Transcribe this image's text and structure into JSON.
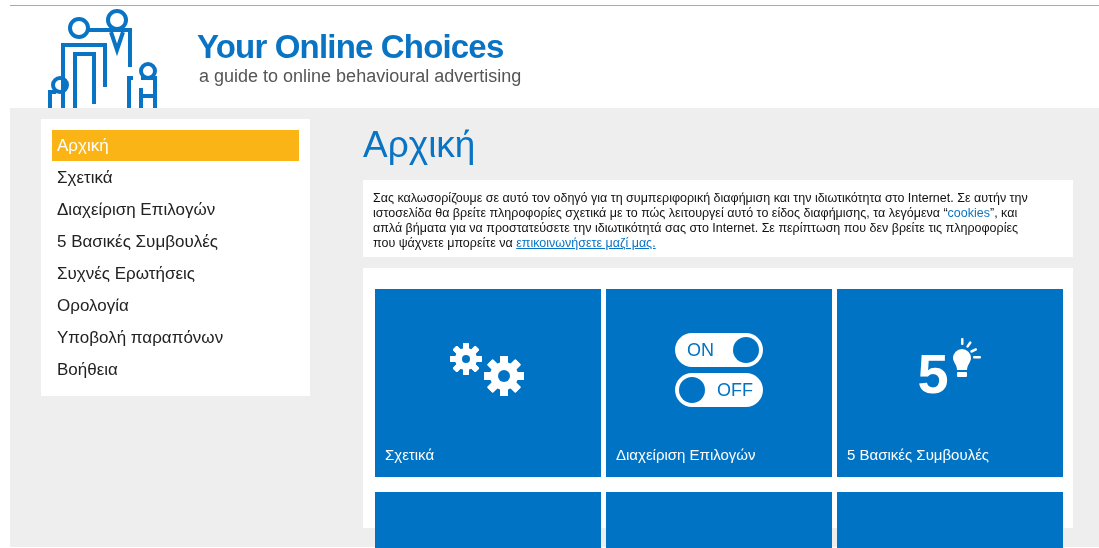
{
  "header": {
    "title": "Your Online Choices",
    "subtitle": "a guide to online behavioural advertising"
  },
  "sidebar": {
    "items": [
      {
        "label": "Αρχική",
        "selected": true
      },
      {
        "label": "Σχετικά",
        "selected": false
      },
      {
        "label": "Διαχείριση Επιλογών",
        "selected": false
      },
      {
        "label": "5 Βασικές Συμβουλές",
        "selected": false
      },
      {
        "label": "Συχνές Ερωτήσεις",
        "selected": false
      },
      {
        "label": "Ορολογία",
        "selected": false
      },
      {
        "label": "Υποβολή παραπόνων",
        "selected": false
      },
      {
        "label": "Βοήθεια",
        "selected": false
      }
    ]
  },
  "page_title": "Αρχική",
  "intro": [
    {
      "kind": "text",
      "text": "Σας καλωσορίζουμε σε αυτό τον οδηγό για τη συμπεριφορική διαφήμιση και την ιδιωτικότητα στο Internet. Σε αυτήν την ιστοσελίδα θα βρείτε πληροφορίες σχετικά με το πώς λειτουργεί αυτό το είδος διαφήμισης, τα λεγόμενα “"
    },
    {
      "kind": "highlight",
      "text": "cookies"
    },
    {
      "kind": "text",
      "text": "”, και απλά βήματα για να προστατεύσετε την ιδιωτικότητά σας στο Internet. Σε περίπτωση που δεν βρείτε τις πληροφορίες που ψάχνετε μπορείτε να "
    },
    {
      "kind": "link",
      "text": "επικοινωνήσετε μαζί μας."
    }
  ],
  "tiles": [
    {
      "kind": "gears",
      "label": "Σχετικά"
    },
    {
      "kind": "switches",
      "label": "Διαχείριση Επιλογών",
      "switches": [
        {
          "text": "ON",
          "on": true
        },
        {
          "text": "OFF",
          "on": false
        }
      ]
    },
    {
      "kind": "five",
      "label": "5 Βασικές Συμβουλές",
      "digit": "5"
    },
    {
      "kind": "blank"
    },
    {
      "kind": "blank"
    },
    {
      "kind": "blank"
    }
  ]
}
